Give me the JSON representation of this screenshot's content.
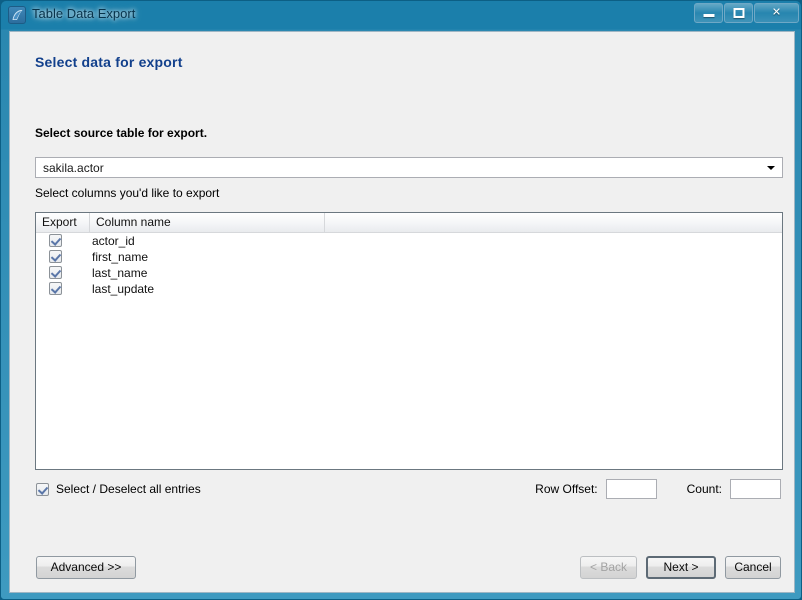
{
  "window": {
    "title": "Table Data Export",
    "icon": "workbench-dolphin-icon",
    "controls": {
      "minimize": "–",
      "maximize": "□",
      "close": "✕"
    }
  },
  "page": {
    "heading": "Select data for export"
  },
  "source": {
    "label": "Select source table for export.",
    "selected_table": "sakila.actor"
  },
  "columns": {
    "label": "Select columns you'd like to export",
    "headers": [
      "Export",
      "Column name",
      ""
    ],
    "rows": [
      {
        "checked": true,
        "name": "actor_id"
      },
      {
        "checked": true,
        "name": "first_name"
      },
      {
        "checked": true,
        "name": "last_name"
      },
      {
        "checked": true,
        "name": "last_update"
      }
    ]
  },
  "select_all": {
    "label": "Select / Deselect all entries",
    "checked": true
  },
  "limits": {
    "row_offset_label": "Row Offset:",
    "row_offset_value": "",
    "count_label": "Count:",
    "count_value": ""
  },
  "footer": {
    "advanced": "Advanced >>",
    "back": "< Back",
    "next": "Next >",
    "cancel": "Cancel"
  },
  "colors": {
    "title_bar": "#1b7fab",
    "heading": "#12408c",
    "dialog_bg": "#f0f0f0",
    "check": "#5a76a8"
  }
}
